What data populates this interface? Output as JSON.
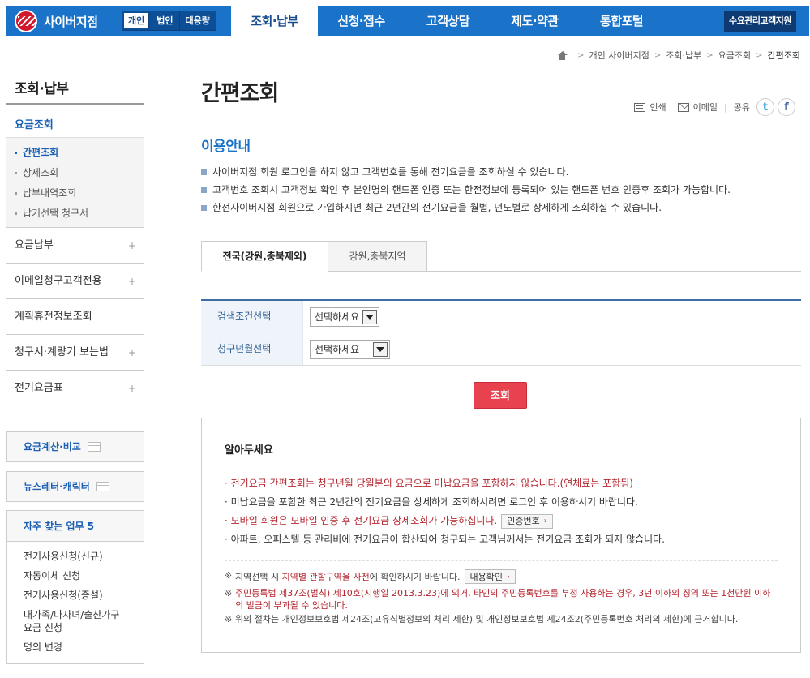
{
  "header": {
    "logo_text": "사이버지점",
    "segments": [
      "개인",
      "법인",
      "대용량"
    ],
    "nav": [
      "조회·납부",
      "신청·접수",
      "고객상담",
      "제도·약관",
      "통합포털"
    ],
    "support": "수요관리고객지원"
  },
  "breadcrumb": [
    "개인 사이버지점",
    "조회·납부",
    "요금조회",
    "간편조회"
  ],
  "utils": {
    "print": "인쇄",
    "email": "이메일",
    "share": "공유",
    "twitter": "t",
    "facebook": "f"
  },
  "lnb": {
    "title": "조회·납부",
    "sub": "요금조회",
    "sub_items": [
      "간편조회",
      "상세조회",
      "납부내역조회",
      "납기선택 청구서"
    ],
    "menus": [
      {
        "label": "요금납부",
        "plus": "+"
      },
      {
        "label": "이메일청구고객전용",
        "plus": "+"
      },
      {
        "label": "계획휴전정보조회",
        "plus": ""
      },
      {
        "label": "청구서·계량기 보는법",
        "plus": "+"
      },
      {
        "label": "전기요금표",
        "plus": "+"
      }
    ],
    "boxes": [
      "요금계산·비교",
      "뉴스레터·캐릭터"
    ],
    "fav_title": "자주 찾는 업무 5",
    "fav_items": [
      "전기사용신청(신규)",
      "자동이체 신청",
      "전기사용신청(증설)",
      "대가족/다자녀/출산가구 요금 신청",
      "명의 변경"
    ]
  },
  "main": {
    "title": "간편조회",
    "section": "이용안내",
    "info": [
      "사이버지점 회원 로그인을 하지 않고 고객번호를 통해 전기요금을 조회하실 수 있습니다.",
      "고객번호 조회시 고객정보 확인 후 본인명의 핸드폰 인증 또는 한전정보에 등록되어 있는 핸드폰 번호 인증후 조회가 가능합니다.",
      "한전사이버지점 회원으로 가입하시면 최근 2년간의 전기요금을 월별, 년도별로 상세하게 조회하실 수 있습니다."
    ],
    "tabs": [
      "전국(강원,충북제외)",
      "강원,충북지역"
    ],
    "form": [
      {
        "label": "검색조건선택",
        "value": "선택하세요"
      },
      {
        "label": "청구년월선택",
        "value": "선택하세요"
      }
    ],
    "search_button": "조회"
  },
  "notice": {
    "title": "알아두세요",
    "items": [
      {
        "text": "· 전기요금 간편조회는 청구년월 당월분의 요금으로 미납요금을 포함하지 않습니다.(연체료는 포함됨)",
        "red": true
      },
      {
        "text": "· 미납요금을 포함한 최근 2년간의 전기요금을 상세하게 조회하시려면 로그인 후 이용하시기 바랍니다.",
        "red": false
      },
      {
        "text": "· 모바일 회원은 모바일 인증 후 전기요금 상세조회가 가능하십니다.",
        "red": true,
        "button": "인증번호"
      },
      {
        "text": "· 아파트, 오피스텔 등 관리비에 전기요금이 합산되어 청구되는 고객님께서는 전기요금 조회가 되지 않습니다.",
        "red": false
      }
    ],
    "notes": {
      "mark": "※",
      "n1_pre": "지역선택 시 ",
      "n1_hl": "지역별 관할구역을 사전",
      "n1_post": "에 확인하시기 바랍니다.",
      "n1_button": "내용확인",
      "n2": "주민등록법 제37조(벌칙) 제10호(시행일 2013.3.23)에 의거, 타인의 주민등록번호를 부정 사용하는 경우, 3년 이하의 징역 또는 1천만원 이하의 벌금이 부과될 수 있습니다.",
      "n3": "위의 절차는 개인정보보호법 제24조(고유식별정보의 처리 제한) 및 개인정보보호법 제24조2(주민등록번호 처리의 제한)에 근거합니다."
    }
  },
  "colors": {
    "brand_blue": "#1a73c9",
    "red": "#e8424f",
    "notice_red": "#b3242e"
  }
}
